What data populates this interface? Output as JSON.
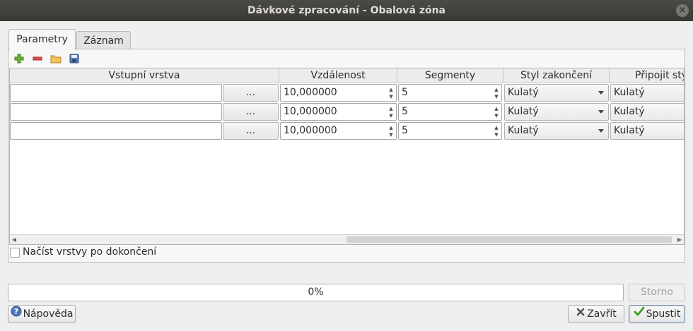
{
  "window": {
    "title": "Dávkové zpracování - Obalová zóna",
    "close_glyph": "×"
  },
  "tabs": [
    {
      "label": "Parametry",
      "active": true
    },
    {
      "label": "Záznam",
      "active": false
    }
  ],
  "toolbar": {
    "icons": [
      "add-row-icon",
      "remove-row-icon",
      "open-folder-icon",
      "save-icon"
    ],
    "colors": {
      "add": "#4e9a06",
      "remove": "#cc2a2a",
      "folder": "#e9b64b",
      "save": "#4a6fa5"
    }
  },
  "table": {
    "columns": [
      "Vstupní vrstva",
      "Vzdálenost",
      "Segmenty",
      "Styl zakončení",
      "Připojit styl"
    ],
    "browse_label": "...",
    "rows": [
      {
        "input_layer": "",
        "distance": "10,000000",
        "segments": "5",
        "end_cap": "Kulatý",
        "join_style": "Kulatý"
      },
      {
        "input_layer": "",
        "distance": "10,000000",
        "segments": "5",
        "end_cap": "Kulatý",
        "join_style": "Kulatý"
      },
      {
        "input_layer": "",
        "distance": "10,000000",
        "segments": "5",
        "end_cap": "Kulatý",
        "join_style": "Kulatý"
      }
    ]
  },
  "load_layers": {
    "label": "Načíst vrstvy po dokončení",
    "checked": false
  },
  "progress": {
    "text": "0%",
    "value": 0
  },
  "buttons": {
    "cancel": "Storno",
    "help": "Nápověda",
    "close": "Zavřít",
    "run": "Spustit"
  }
}
